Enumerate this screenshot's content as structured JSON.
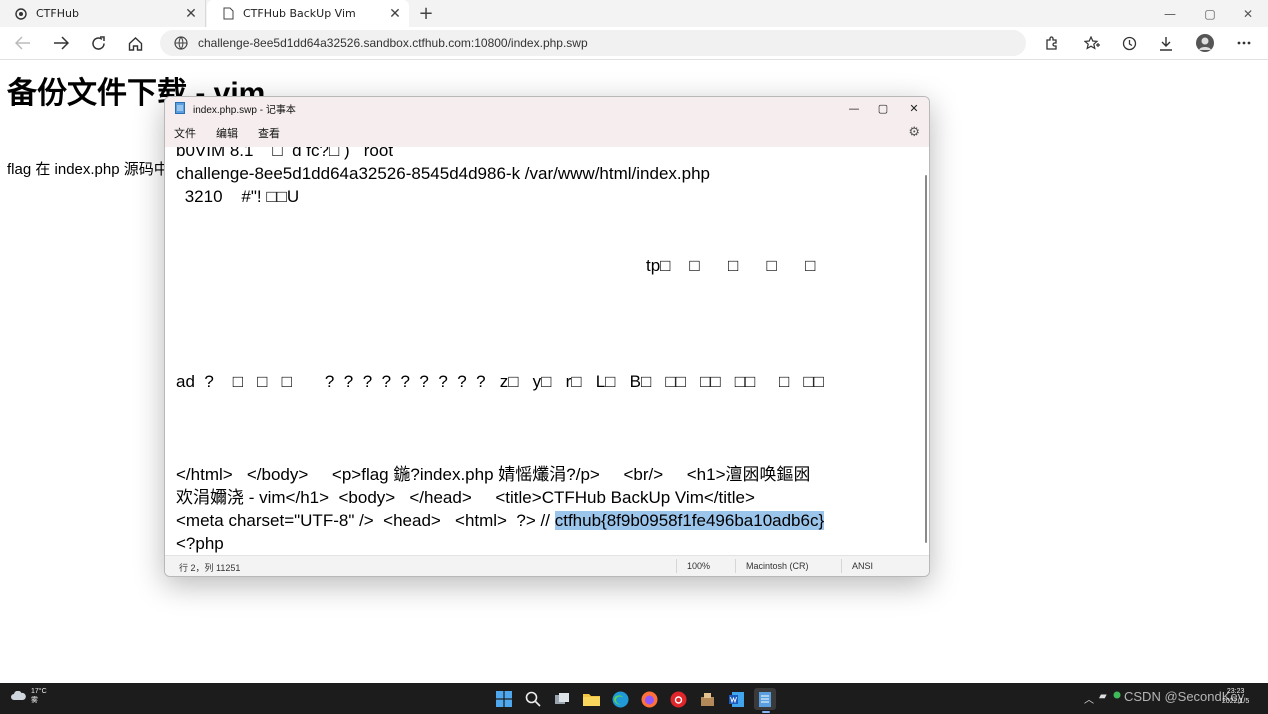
{
  "browser": {
    "tabs": [
      {
        "title": "CTFHub",
        "active": false
      },
      {
        "title": "CTFHub BackUp Vim",
        "active": true
      }
    ],
    "new_tab_glyph": "+",
    "address": {
      "url": "challenge-8ee5d1dd64a32526.sandbox.ctfhub.com:10800/index.php.swp"
    },
    "toolbar_icons": [
      "back-icon",
      "forward-icon",
      "refresh-icon",
      "home-icon",
      "site-info-icon",
      "extensions-icon",
      "favorites-icon",
      "history-icon",
      "downloads-icon",
      "profile-avatar",
      "more-icon"
    ]
  },
  "page": {
    "heading": "备份文件下载 - vim",
    "paragraph": "flag 在 index.php 源码中"
  },
  "notepad": {
    "title": "index.php.swp - 记事本",
    "menu": [
      "文件",
      "编辑",
      "查看"
    ],
    "lines": [
      {
        "text": "b0VIM 8.1    □  d fc?□ )   root"
      },
      {
        "text": "challenge-8ee5d1dd64a32526-8545d4d986-k /var/www/html/index.php"
      },
      {
        "text": " 3210    #\"! □□U"
      },
      {
        "text": "tp□    □      □      □      □"
      },
      {
        "text": "ad  ?    □   □   □       ?  ?  ?  ?  ?  ?  ?  ?  ?   z□   y□   r□   L□   B□   □□   □□   □□     □   □□"
      },
      {
        "text": "</html>   </body>     <p>flag 鍦?index.php 婧愮爜涓?/p>     <br/>     <h1>澶囦唤鏂囦"
      },
      {
        "text": "欢涓嬭浇 - vim</h1>  <body>   </head>     <title>CTFHub BackUp Vim</title>"
      },
      {
        "text": "<meta charset=\"UTF-8\" />  <head>   <html>  ?> // ",
        "selected": "ctfhub{8f9b0958f1fe496ba10adb6c}"
      },
      {
        "text": "<?php"
      }
    ],
    "status": {
      "position": "行 2，列 11251",
      "zoom": "100%",
      "line_ending": "Macintosh (CR)",
      "encoding": "ANSI"
    }
  },
  "taskbar": {
    "weather_temp": "17°C",
    "weather_desc": "雾",
    "watermark": "CSDN @SecondKey",
    "time": "23:23",
    "date": "2022/1/5"
  }
}
